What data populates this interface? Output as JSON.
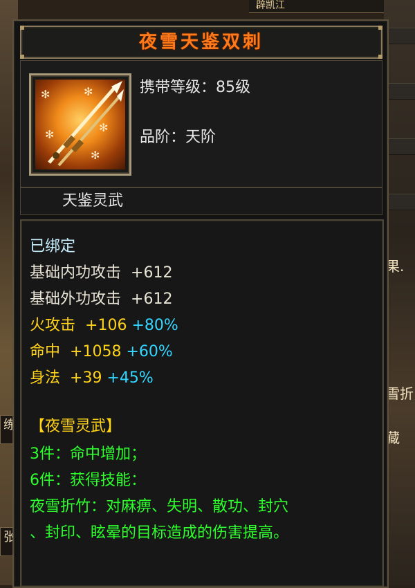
{
  "background": {
    "top_fragment": "辟凯江",
    "right_fragments": [
      "果.",
      "雪折",
      "藏"
    ],
    "left_fragments": [
      "练",
      "张"
    ]
  },
  "item": {
    "name": "夜雪天鉴双刺",
    "icon": "twin-dagger-icon",
    "level_requirement": "携带等级：85级",
    "grade": "品阶：天阶",
    "category": "天鉴灵武"
  },
  "stats": {
    "bound": "已绑定",
    "base_lines": [
      {
        "label": "基础内功攻击",
        "value": "+612"
      },
      {
        "label": "基础外功攻击",
        "value": "+612"
      }
    ],
    "bonus_lines": [
      {
        "label": "火攻击",
        "value": "+106",
        "pct": "+80%"
      },
      {
        "label": "命中",
        "value": "+1058",
        "pct": "+60%"
      },
      {
        "label": "身法",
        "value": "+39",
        "pct": "+45%"
      }
    ]
  },
  "set": {
    "title": "【夜雪灵武】",
    "lines": [
      "3件：命中增加；",
      "6件：获得技能：",
      "夜雪折竹：对麻痹、失明、散功、封穴",
      "、封印、眩晕的目标造成的伤害提高。"
    ]
  },
  "colors": {
    "title": "#ff7a1a",
    "bound": "#c8f0ff",
    "fire": "#ffd319",
    "percent": "#33d6ff",
    "set_text": "#2cff2c"
  }
}
